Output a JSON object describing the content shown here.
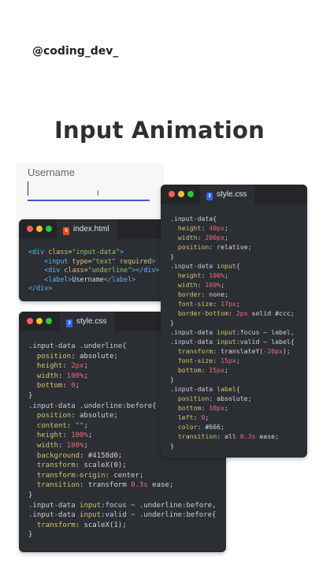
{
  "handle": "@coding_dev_",
  "title": "Input Animation",
  "demo": {
    "label": "Username",
    "underline_color": "#4158d0"
  },
  "windows": {
    "html": {
      "tab": "index.html"
    },
    "css_top": {
      "tab": "style.css"
    },
    "css_bottom": {
      "tab": "style.css"
    }
  },
  "colors": {
    "editor_bg": "#2b2e33",
    "accent": "#4158d0"
  },
  "icons": [
    "html5-file-icon",
    "css3-file-icon"
  ]
}
